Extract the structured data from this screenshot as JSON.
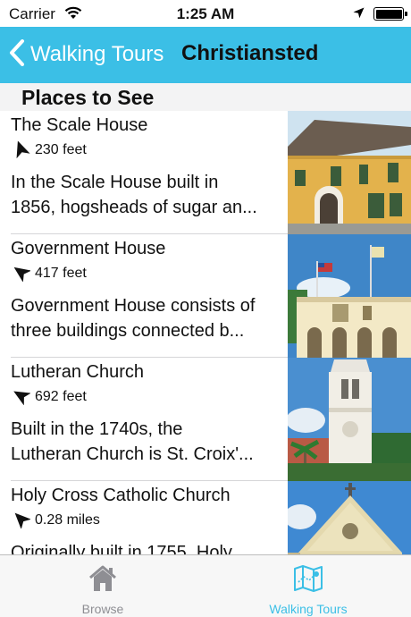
{
  "status_bar": {
    "carrier": "Carrier",
    "time": "1:25 AM"
  },
  "nav": {
    "back_label": "Walking Tours",
    "title": "Christiansted",
    "bar_color": "#3bbfe6"
  },
  "section": {
    "header": "Places to See"
  },
  "places": [
    {
      "name": "The Scale House",
      "distance": "230 feet",
      "description_lines": [
        "In the Scale House built in",
        "1856, hogsheads of sugar an..."
      ],
      "image": "scale-house-photo"
    },
    {
      "name": "Government House",
      "distance": "417 feet",
      "description_lines": [
        "Government House consists of",
        "three buildings connected b..."
      ],
      "image": "government-house-photo"
    },
    {
      "name": "Lutheran Church",
      "distance": "692 feet",
      "description_lines": [
        "Built in the 1740s, the",
        "Lutheran Church is St. Croix'..."
      ],
      "image": "lutheran-church-photo"
    },
    {
      "name": "Holy Cross Catholic Church",
      "distance": "0.28 miles",
      "description_lines": [
        "Originally built in 1755, Holy",
        ""
      ],
      "image": "holy-cross-church-photo"
    }
  ],
  "tabs": [
    {
      "label": "Browse",
      "icon": "house-icon",
      "selected": false
    },
    {
      "label": "Walking Tours",
      "icon": "map-icon",
      "selected": true
    }
  ]
}
